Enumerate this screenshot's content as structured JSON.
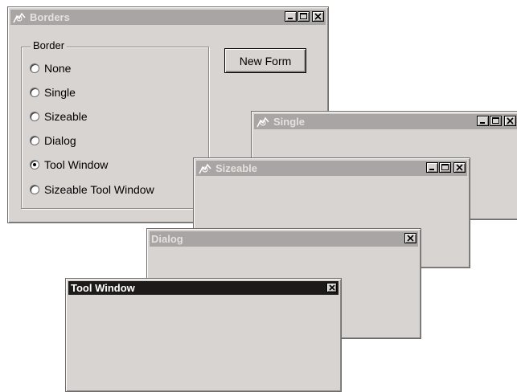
{
  "windows": {
    "borders": {
      "title": "Borders",
      "group_label": "Border",
      "options": [
        {
          "label": "None",
          "selected": false
        },
        {
          "label": "Single",
          "selected": false
        },
        {
          "label": "Sizeable",
          "selected": false
        },
        {
          "label": "Dialog",
          "selected": false
        },
        {
          "label": "Tool Window",
          "selected": true
        },
        {
          "label": "Sizeable Tool Window",
          "selected": false
        }
      ],
      "new_form_label": "New Form"
    },
    "single": {
      "title": "Single"
    },
    "sizeable": {
      "title": "Sizeable"
    },
    "dialog": {
      "title": "Dialog"
    },
    "tool_window": {
      "title": "Tool Window"
    }
  },
  "icons": {
    "app": "vb-form-icon",
    "minimize": "minimize-icon",
    "maximize": "maximize-icon",
    "close": "close-icon"
  },
  "colors": {
    "window_face": "#d8d4d2",
    "inactive_titlebar": "#a9a5a4",
    "inactive_title_text": "#e4e1df",
    "active_titlebar": "#1e1a19"
  }
}
